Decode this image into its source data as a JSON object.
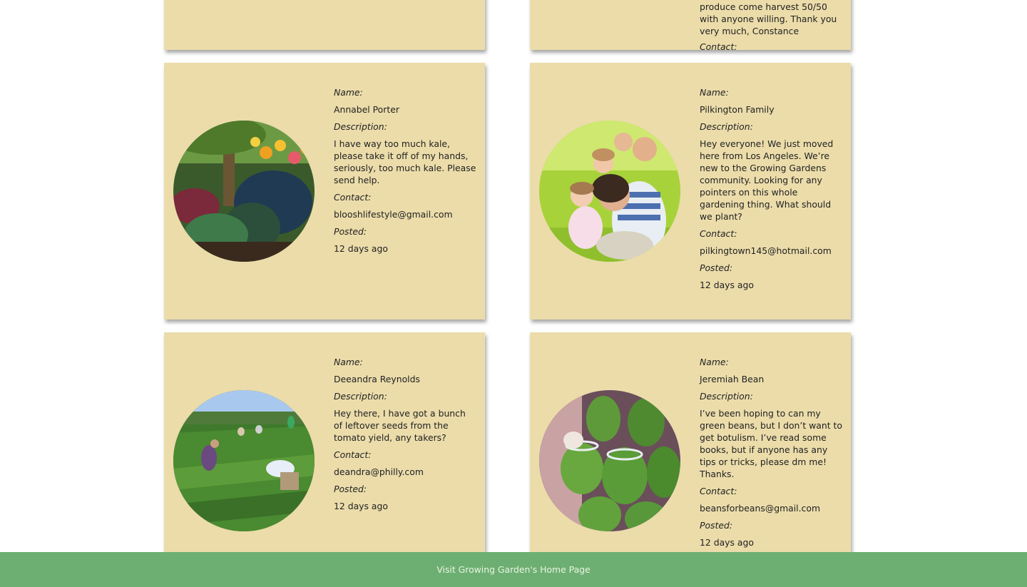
{
  "top_cards": {
    "left": {},
    "right": {
      "description_tail": "produce come harvest 50/50 with anyone willing. Thank you very much, Constance",
      "contact_label": "Contact:"
    }
  },
  "labels": {
    "name": "Name:",
    "description": "Description:",
    "contact": "Contact:",
    "posted": "Posted:"
  },
  "posts": [
    {
      "name": "Annabel Porter",
      "description": "I have way too much kale, please take it off of my hands, seriously, too much kale. Please send help.",
      "contact": "blooshlifestyle@gmail.com",
      "posted": "12 days ago",
      "photo": "kale-garden"
    },
    {
      "name": "Pilkington Family",
      "description": "Hey everyone! We just moved here from Los Angeles. We’re new to the Growing Gardens community. Looking for any pointers on this whole gardening thing. What should we plant?",
      "contact": "pilkingtown145@hotmail.com",
      "posted": "12 days ago",
      "photo": "family-in-grass"
    },
    {
      "name": "Deeandra Reynolds",
      "description": "Hey there, I have got a bunch of leftover seeds from the tomato yield, any takers?",
      "contact": "deandra@philly.com",
      "posted": "12 days ago",
      "photo": "field-workers"
    },
    {
      "name": "Jeremiah Bean",
      "description": "I’ve been hoping to can my green beans, but I don’t want to get botulism. I’ve read some books, but if anyone has any tips or tricks, please dm me! Thanks.",
      "contact": "beansforbeans@gmail.com",
      "posted": "12 days ago",
      "photo": "green-bean-jars"
    }
  ],
  "footer": {
    "link_label": "Visit Growing Garden's Home Page"
  },
  "colors": {
    "card": "#ebdcaa",
    "footer": "#6daf72",
    "footer_text": "#eaf4e2"
  }
}
